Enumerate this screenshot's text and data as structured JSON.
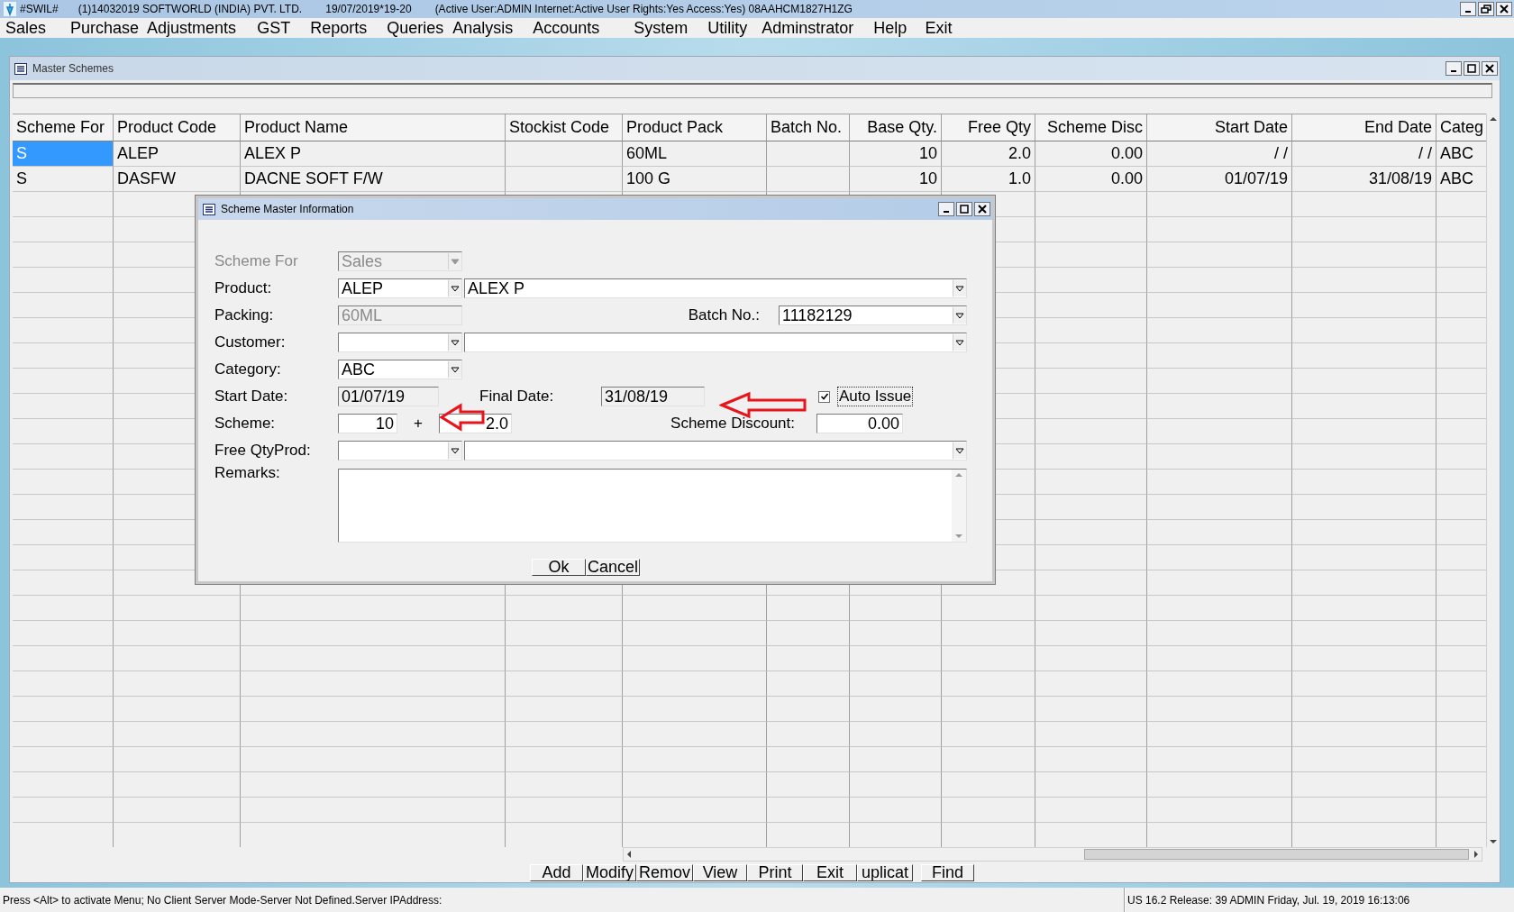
{
  "app_title_bar": {
    "texts": [
      "#SWIL#",
      "(1)14032019 SOFTWORLD (INDIA) PVT. LTD.",
      "19/07/2019*19-20",
      "(Active User:ADMIN Internet:Active  User Rights:Yes Access:Yes) 08AAHCM1827H1ZG"
    ]
  },
  "menu_bar": [
    "Sales",
    "Purchase",
    "Adjustments",
    "GST",
    "Reports",
    "Queries",
    "Analysis",
    "Accounts",
    "System",
    "Utility",
    "Adminstrator",
    "Help",
    "Exit"
  ],
  "master_window": {
    "title": "Master Schemes",
    "table": {
      "columns": [
        "Scheme For",
        "Product Code",
        "Product Name",
        "Stockist Code",
        "Product Pack",
        "Batch No.",
        "Base Qty.",
        "Free Qty",
        "Scheme Disc",
        "Start Date",
        "End Date",
        "Categ"
      ],
      "rows": [
        {
          "selected": true,
          "cells": [
            "S",
            "ALEP",
            "ALEX P",
            "",
            "60ML",
            "",
            "10",
            "2.0",
            "0.00",
            "/  /",
            "/  /",
            "ABC"
          ]
        },
        {
          "selected": false,
          "cells": [
            "S",
            "DASFW",
            "DACNE SOFT F/W",
            "",
            "100 G",
            "",
            "10",
            "1.0",
            "0.00",
            "01/07/19",
            "31/08/19",
            "ABC"
          ]
        }
      ]
    },
    "buttons": [
      "Add",
      "Modify",
      "Remov",
      "View",
      "Print",
      "Exit",
      "uplicat",
      "Find"
    ]
  },
  "dialog": {
    "title": "Scheme Master Information",
    "scheme_for": {
      "label": "Scheme For",
      "value": "Sales",
      "disabled": true
    },
    "product": {
      "label": "Product:",
      "code": "ALEP",
      "name": "ALEX P"
    },
    "packing": {
      "label": "Packing:",
      "value": "60ML",
      "disabled": true
    },
    "batch_no": {
      "label": "Batch No.:",
      "value": "11182129"
    },
    "customer": {
      "label": "Customer:"
    },
    "category": {
      "label": "Category:",
      "value": "ABC"
    },
    "start_date": {
      "label": "Start Date:",
      "value": "01/07/19"
    },
    "final_date": {
      "label": "Final Date:",
      "value": "31/08/19"
    },
    "auto_issue": {
      "label": "Auto Issue",
      "checked": true
    },
    "scheme": {
      "label": "Scheme:",
      "base_qty": "10",
      "plus": "+",
      "free_qty": "2.0"
    },
    "scheme_discount": {
      "label": "Scheme Discount:",
      "value": "0.00"
    },
    "free_qty_prod": {
      "label": "Free QtyProd:"
    },
    "remarks": {
      "label": "Remarks:"
    },
    "buttons": [
      "Ok",
      "Cancel"
    ]
  },
  "status_bar": {
    "left": "Press <Alt> to activate Menu; No Client Server Mode-Server Not Defined.Server IPAddress:",
    "right": "US 16.2 Release: 39  ADMIN  Friday, Jul. 19, 2019  16:13:06"
  }
}
